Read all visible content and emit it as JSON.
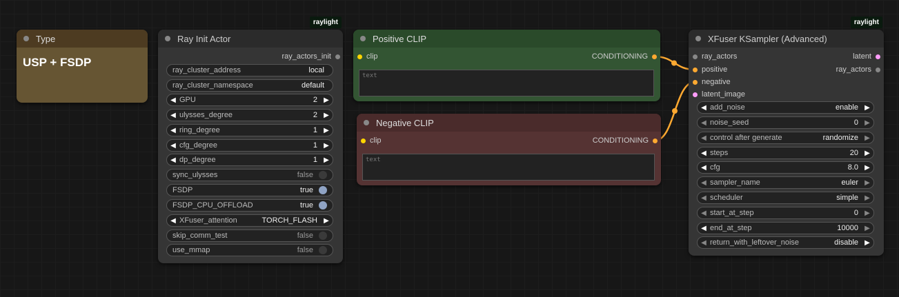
{
  "type_node": {
    "title": "Type",
    "body_text": "USP + FSDP"
  },
  "ray_init": {
    "badge": "raylight",
    "title": "Ray Init Actor",
    "output": "ray_actors_init",
    "widgets": [
      {
        "label": "ray_cluster_address",
        "value": "local"
      },
      {
        "label": "ray_cluster_namespace",
        "value": "default"
      },
      {
        "label": "GPU",
        "value": "2"
      },
      {
        "label": "ulysses_degree",
        "value": "2"
      },
      {
        "label": "ring_degree",
        "value": "1"
      },
      {
        "label": "cfg_degree",
        "value": "1"
      },
      {
        "label": "dp_degree",
        "value": "1"
      },
      {
        "label": "sync_ulysses",
        "value": "false"
      },
      {
        "label": "FSDP",
        "value": "true"
      },
      {
        "label": "FSDP_CPU_OFFLOAD",
        "value": "true"
      },
      {
        "label": "XFuser_attention",
        "value": "TORCH_FLASH"
      },
      {
        "label": "skip_comm_test",
        "value": "false"
      },
      {
        "label": "use_mmap",
        "value": "false"
      }
    ]
  },
  "positive_clip": {
    "title": "Positive CLIP",
    "input": "clip",
    "output": "CONDITIONING",
    "text_placeholder": "text"
  },
  "negative_clip": {
    "title": "Negative CLIP",
    "input": "clip",
    "output": "CONDITIONING",
    "text_placeholder": "text"
  },
  "ksampler": {
    "badge": "raylight",
    "title": "XFuser KSampler (Advanced)",
    "inputs": [
      "ray_actors",
      "positive",
      "negative",
      "latent_image"
    ],
    "outputs": [
      "latent",
      "ray_actors"
    ],
    "widgets": [
      {
        "label": "add_noise",
        "value": "enable"
      },
      {
        "label": "noise_seed",
        "value": "0"
      },
      {
        "label": "control after generate",
        "value": "randomize"
      },
      {
        "label": "steps",
        "value": "20"
      },
      {
        "label": "cfg",
        "value": "8.0"
      },
      {
        "label": "sampler_name",
        "value": "euler"
      },
      {
        "label": "scheduler",
        "value": "simple"
      },
      {
        "label": "start_at_step",
        "value": "0"
      },
      {
        "label": "end_at_step",
        "value": "10000"
      },
      {
        "label": "return_with_leftover_noise",
        "value": "disable"
      }
    ]
  },
  "colors": {
    "canvas": "#171717",
    "type_node_body": "#665533",
    "type_node_header": "#4d3b21",
    "positive_header": "#2a4a2a",
    "positive_body": "#335533",
    "negative_header": "#4a2b2b",
    "negative_body": "#553333",
    "conditioning_slot": "#ffa931",
    "clip_slot": "#ffd500",
    "latent_slot": "#ff9cf9",
    "ray_slot": "#888888",
    "link": "#ffa931"
  }
}
